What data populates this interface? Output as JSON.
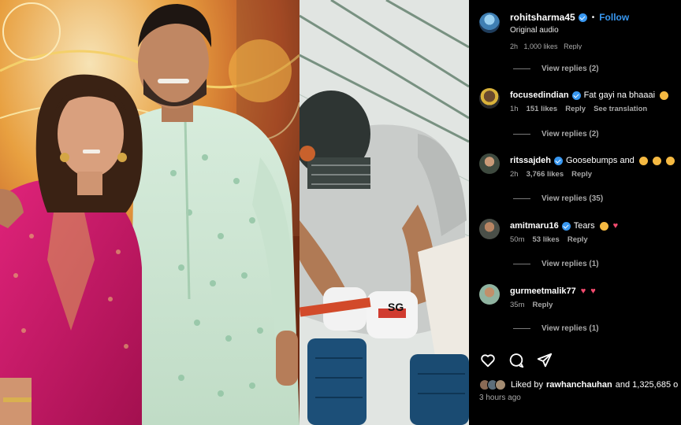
{
  "post": {
    "username": "rohitsharma45",
    "follow_label": "Follow",
    "separator": "•",
    "audio": "Original audio",
    "time_ago": "3 hours ago",
    "liked_prefix": "Liked by",
    "liked_user": "rawhanchauhan",
    "liked_suffix": "and 1,325,685 o"
  },
  "cut_off_row": {
    "time": "2h",
    "likes": "1,000 likes",
    "reply": "Reply"
  },
  "replies": [
    {
      "label": "View replies (2)"
    },
    {
      "label": "View replies (2)"
    },
    {
      "label": "View replies (35)"
    },
    {
      "label": "View replies (1)"
    },
    {
      "label": "View replies (1)"
    }
  ],
  "comments": [
    {
      "user": "focusedindian",
      "text": "Fat gayi na bhaaai",
      "time": "1h",
      "likes": "151 likes",
      "reply": "Reply",
      "translate": "See translation",
      "emoji": [
        "face"
      ]
    },
    {
      "user": "ritssajdeh",
      "text": "Goosebumps and",
      "time": "2h",
      "likes": "3,766 likes",
      "reply": "Reply",
      "emoji": [
        "face",
        "face",
        "face"
      ]
    },
    {
      "user": "amitmaru16",
      "text": "Tears",
      "time": "50m",
      "likes": "53 likes",
      "reply": "Reply",
      "emoji": [
        "face",
        "heart"
      ]
    },
    {
      "user": "gurmeetmalik77",
      "text": "",
      "time": "35m",
      "likes": "",
      "reply": "Reply",
      "emoji": [
        "heart",
        "heart"
      ]
    }
  ],
  "icons": {
    "like": "heart-outline-icon",
    "comment": "comment-bubble-icon",
    "share": "paper-plane-icon",
    "verified": "verified-badge-icon"
  },
  "colors": {
    "follow_blue": "#3897f0",
    "panel_bg": "#000000",
    "muted_text": "#a8a8a8",
    "heart_pink": "#f24a6e"
  }
}
